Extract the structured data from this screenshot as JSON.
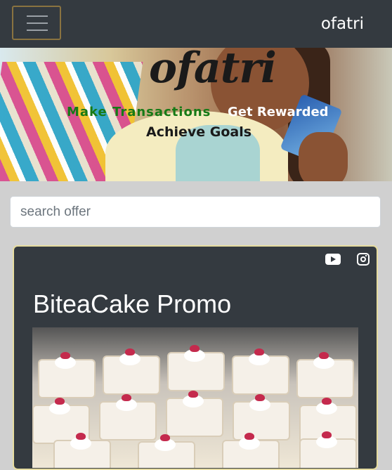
{
  "navbar": {
    "brand": "ofatri",
    "menu_icon": "hamburger-menu-icon"
  },
  "hero": {
    "logo_text": "ofatri",
    "tagline_1": "Make Transactions",
    "tagline_2": "Get Rewarded",
    "tagline_3": "Achieve Goals"
  },
  "search": {
    "placeholder": "search offer",
    "value": ""
  },
  "offer": {
    "title": "BiteaCake Promo",
    "social_icons": [
      "youtube-icon",
      "instagram-icon"
    ]
  },
  "colors": {
    "navbar_bg": "#343a40",
    "page_bg": "#d0d0d0",
    "card_border": "#e6dca0",
    "tagline_green": "#167a16"
  }
}
